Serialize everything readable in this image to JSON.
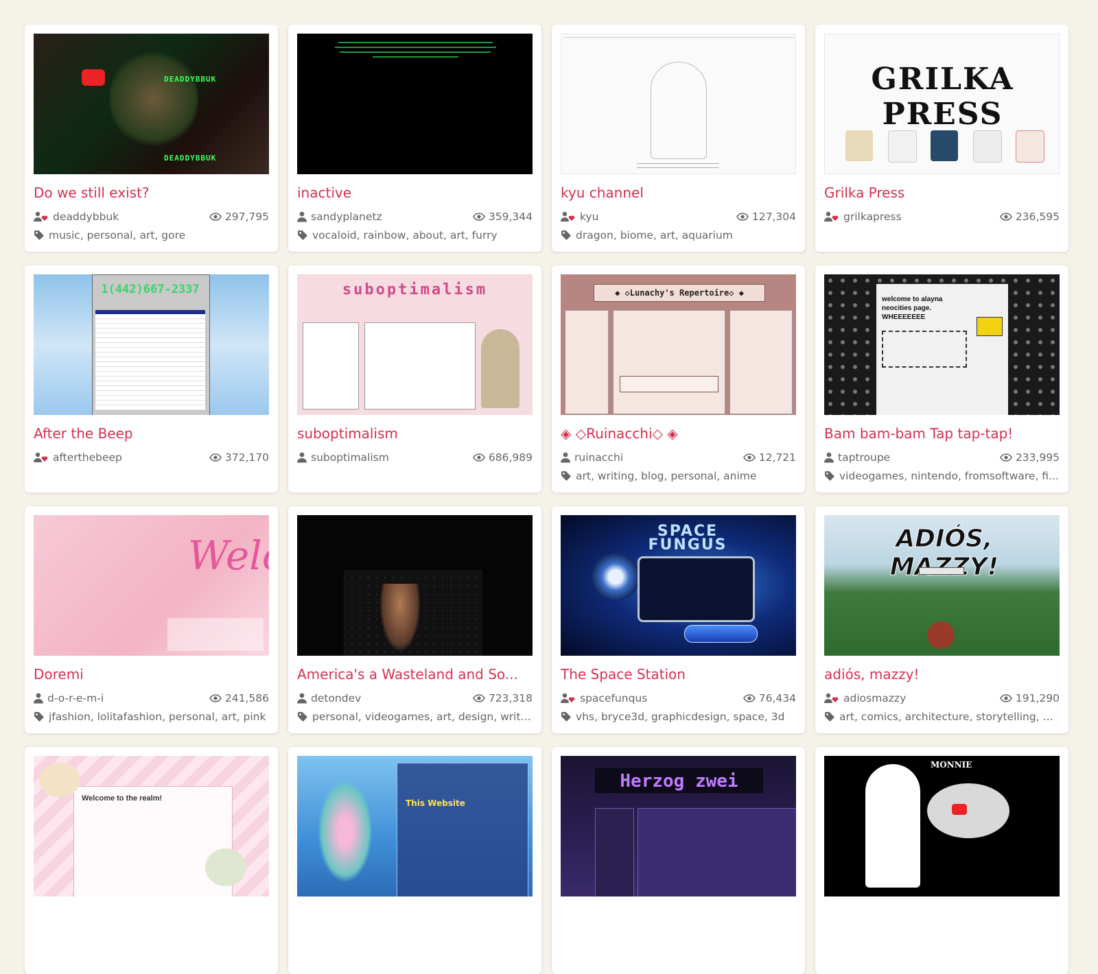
{
  "icons": {
    "user": "user-icon",
    "supporter": "supporter-heart-icon",
    "views": "eye-icon",
    "tags": "tag-icon"
  },
  "colors": {
    "background": "#f5f2ea",
    "title": "#d5304f",
    "text": "#666666",
    "supporter_heart": "#d5304f"
  },
  "sites": [
    {
      "title": "Do we still exist?",
      "user": "deaddybbuk",
      "supporter": true,
      "views": "297,795",
      "tags": "music, personal, art, gore",
      "thumb_text": "DEADDYBBUK"
    },
    {
      "title": "inactive",
      "user": "sandyplanetz",
      "supporter": false,
      "views": "359,344",
      "tags": "vocaloid, rainbow, about, art, furry",
      "thumb_text": ""
    },
    {
      "title": "kyu channel",
      "user": "kyu",
      "supporter": true,
      "views": "127,304",
      "tags": "dragon, biome, art, aquarium",
      "thumb_text": ""
    },
    {
      "title": "Grilka Press",
      "user": "grilkapress",
      "supporter": true,
      "views": "236,595",
      "tags": "",
      "thumb_text": "GRILKA PRESS"
    },
    {
      "title": "After the Beep",
      "user": "afterthebeep",
      "supporter": true,
      "views": "372,170",
      "tags": "",
      "thumb_text": "1(442)667-2337"
    },
    {
      "title": "suboptimalism",
      "user": "suboptimalism",
      "supporter": false,
      "views": "686,989",
      "tags": "",
      "thumb_text": "suboptimalism"
    },
    {
      "title": "◈ ◇Ruinacchi◇ ◈",
      "user": "ruinacchi",
      "supporter": false,
      "views": "12,721",
      "tags": "art, writing, blog, personal, anime",
      "thumb_text": "◆ ◇Lunachy's Repertoire◇ ◆"
    },
    {
      "title": "Bam bam-bam Tap tap-tap!",
      "user": "taptroupe",
      "supporter": true,
      "views": "233,995",
      "tags": "videogames, nintendo, fromsoftware, fi...",
      "thumb_text": "welcome to alayna neocities page. WHEEEEEEE"
    },
    {
      "title": "Doremi",
      "user": "d-o-r-e-m-i",
      "supporter": false,
      "views": "241,586",
      "tags": "jfashion, lolitafashion, personal, art, pink",
      "thumb_text": "Welc"
    },
    {
      "title": "America's a Wasteland and So...",
      "user": "detondev",
      "supporter": false,
      "views": "723,318",
      "tags": "personal, videogames, art, design, writi...",
      "thumb_text": ""
    },
    {
      "title": "The Space Station",
      "user": "spacefunqus",
      "supporter": true,
      "views": "76,434",
      "tags": "vhs, bryce3d, graphicdesign, space, 3d",
      "thumb_text": "SPACE FUNGUS"
    },
    {
      "title": "adiós, mazzy!",
      "user": "adiosmazzy",
      "supporter": true,
      "views": "191,290",
      "tags": "art, comics, architecture, storytelling, m...",
      "thumb_text": "ADIÓS, MAZZY!"
    },
    {
      "title": "",
      "user": "",
      "supporter": false,
      "views": "",
      "tags": "",
      "thumb_text": "Welcome to the realm!"
    },
    {
      "title": "",
      "user": "",
      "supporter": false,
      "views": "",
      "tags": "",
      "thumb_text": "This Website"
    },
    {
      "title": "",
      "user": "",
      "supporter": false,
      "views": "",
      "tags": "",
      "thumb_text": "Herzog zwei"
    },
    {
      "title": "",
      "user": "",
      "supporter": false,
      "views": "",
      "tags": "",
      "thumb_text": "MONNIE"
    }
  ]
}
